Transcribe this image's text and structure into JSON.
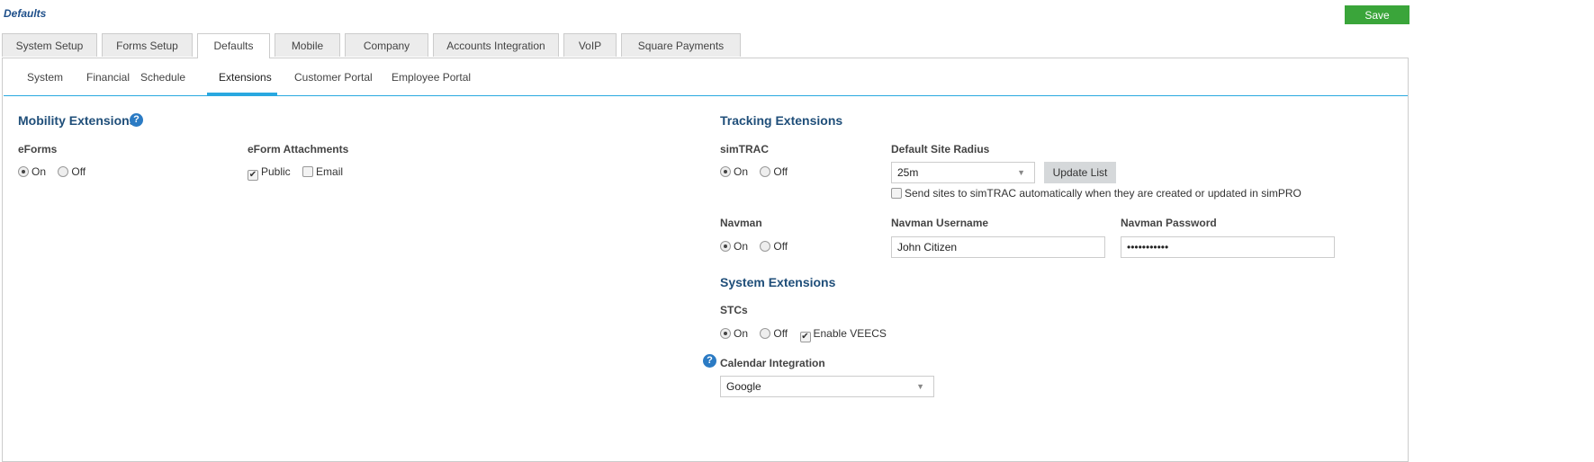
{
  "page": {
    "title": "Defaults",
    "save_label": "Save"
  },
  "tabs": [
    "System Setup",
    "Forms Setup",
    "Defaults",
    "Mobile",
    "Company",
    "Accounts Integration",
    "VoIP",
    "Square Payments"
  ],
  "subtabs": [
    "System",
    "Financial",
    "Schedule",
    "Extensions",
    "Customer Portal",
    "Employee Portal"
  ],
  "mobility": {
    "heading": "Mobility Extensions",
    "eforms_label": "eForms",
    "eforms_on": "On",
    "eforms_off": "Off",
    "eforms_value": "On",
    "attach_label": "eForm Attachments",
    "public": "Public",
    "public_checked": true,
    "email": "Email",
    "email_checked": false
  },
  "tracking": {
    "heading": "Tracking Extensions",
    "simtrac_label": "simTRAC",
    "on": "On",
    "off": "Off",
    "simtrac_value": "On",
    "radius_label": "Default Site Radius",
    "radius_value": "25m",
    "update_label": "Update List",
    "send_label": "Send sites to simTRAC automatically when they are created or updated in simPRO",
    "send_checked": false,
    "navman_label": "Navman",
    "navman_value": "On",
    "username_label": "Navman Username",
    "username_value": "John Citizen",
    "password_label": "Navman Password",
    "password_value": "•••••••••••"
  },
  "system": {
    "heading": "System Extensions",
    "stcs_label": "STCs",
    "stcs_value": "On",
    "veecs_label": "Enable VEECS",
    "veecs_checked": true,
    "calendar_label": "Calendar Integration",
    "calendar_value": "Google"
  }
}
